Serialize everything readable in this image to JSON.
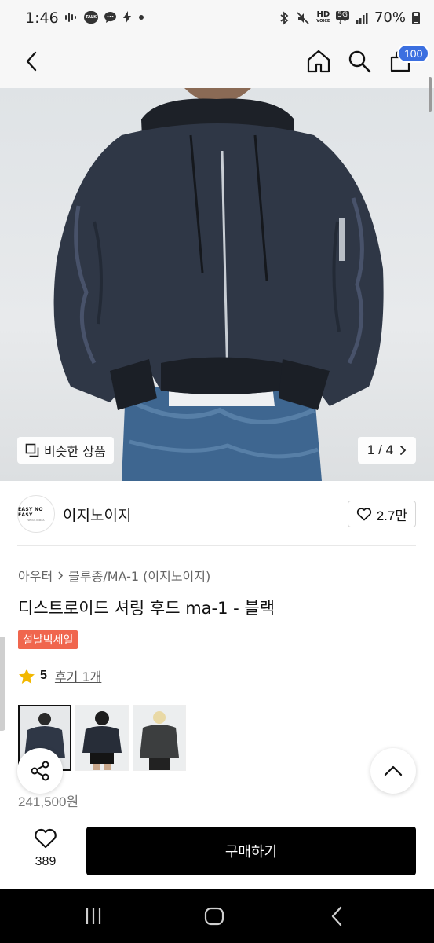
{
  "status_bar": {
    "time": "1:46",
    "battery": "70%",
    "talk_label": "TALK",
    "hd_label": "HD",
    "voice_label": "VOICE",
    "network": "5G"
  },
  "header": {
    "cart_count": "100"
  },
  "gallery": {
    "similar_label": "비슷한 상품",
    "pager": "1 / 4"
  },
  "brand": {
    "logo_line1": "EASY NO EASY",
    "logo_line2": "SEOUL KOREA",
    "name": "이지노이지",
    "likes": "2.7만"
  },
  "breadcrumb": {
    "category": "아우터",
    "subcategory": "블루종/MA-1 (이지노이지)"
  },
  "product": {
    "title": "디스트로이드 셔링 후드 ma-1 - 블랙",
    "sale_badge": "설날빅세일",
    "rating": "5",
    "reviews": "후기 1개",
    "original_price": "241,500원"
  },
  "buy_bar": {
    "wish_count": "389",
    "buy_label": "구매하기"
  },
  "colors": {
    "accent_blue": "#3b6fe0",
    "sale_red": "#f0664e",
    "star": "#f2b800",
    "buy_button": "#000000"
  }
}
